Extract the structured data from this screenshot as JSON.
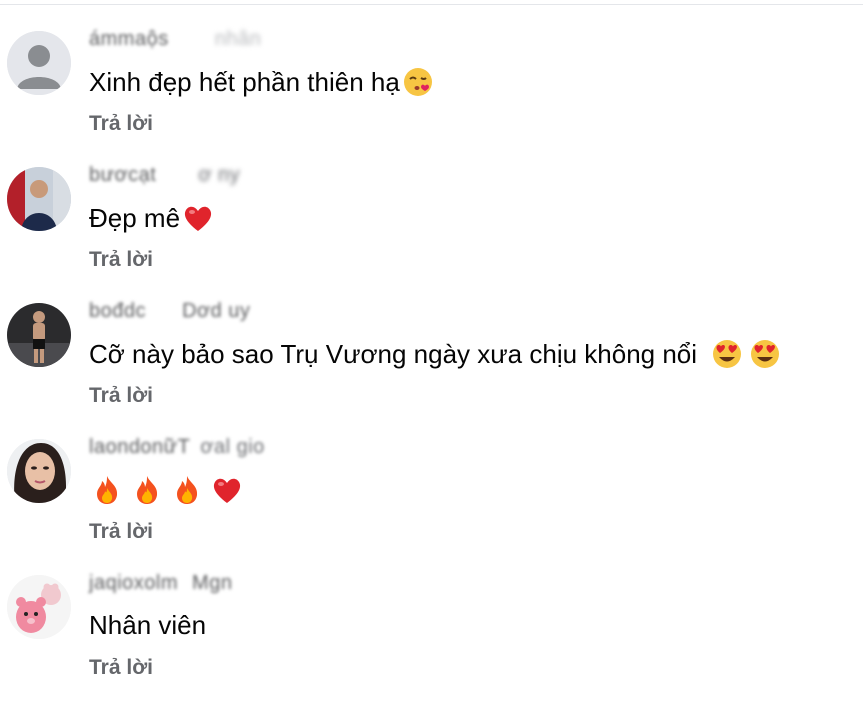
{
  "comments": [
    {
      "name_main": "ámmaộs",
      "name_tail": "nhân",
      "text": "Xinh đẹp hết phần thiên hạ",
      "emojis": [
        "kissing-heart-emoji"
      ],
      "reply": "Trả lời"
    },
    {
      "name_main": "bươcạt",
      "name_tail": "ơ ny",
      "text": "Đẹp mê",
      "emojis": [
        "red-heart-emoji"
      ],
      "reply": "Trả lời"
    },
    {
      "name_main": "bođdc",
      "name_tail": "Dơd uy",
      "text": "Cỡ này bảo sao Trụ Vương ngày xưa chịu không nổi",
      "emojis": [
        "heart-eyes-emoji",
        "heart-eyes-emoji"
      ],
      "reply": "Trả lời"
    },
    {
      "name_main": "laondonữT",
      "name_tail": "ơal gio",
      "text": "",
      "emojis": [
        "fire-emoji",
        "fire-emoji",
        "fire-emoji",
        "red-heart-emoji"
      ],
      "reply": "Trả lời"
    },
    {
      "name_main": "jaqioxolm",
      "name_tail": "Mgn",
      "text": "Nhân viên",
      "emojis": [],
      "reply": "Trả lời"
    }
  ]
}
